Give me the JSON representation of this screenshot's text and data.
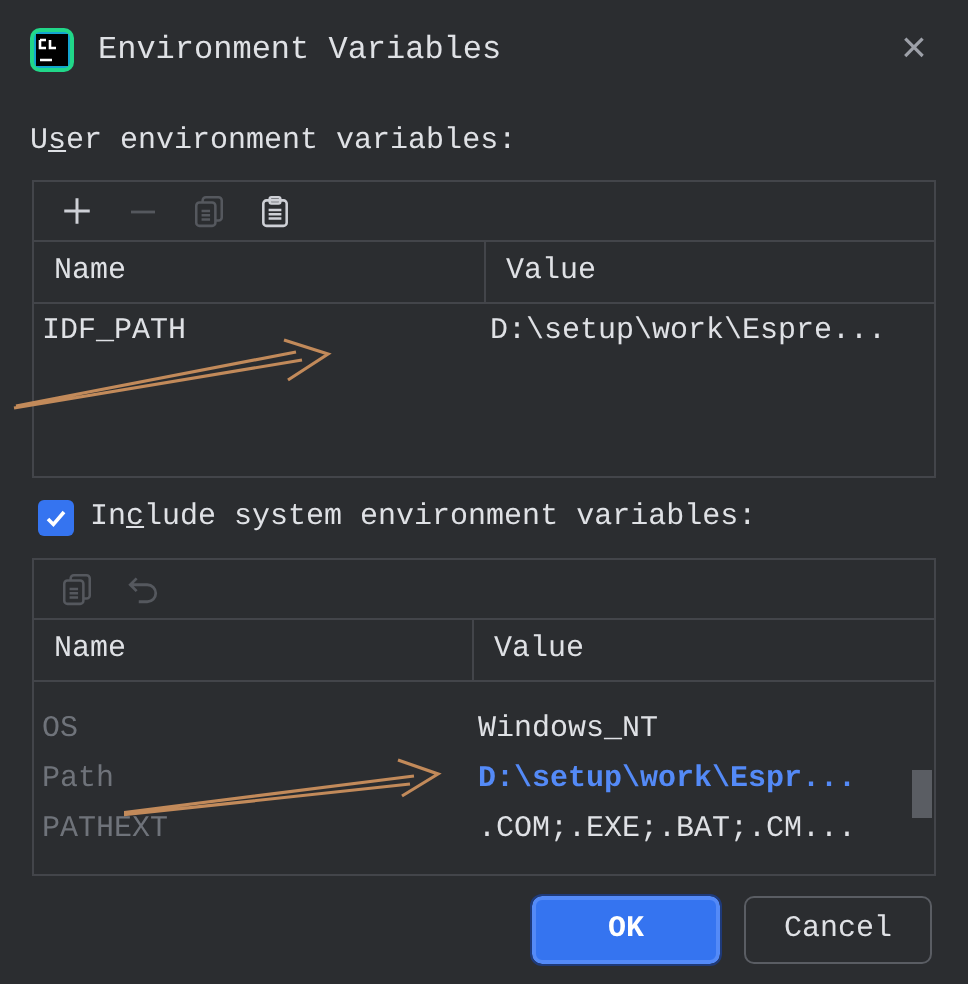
{
  "window": {
    "title": "Environment Variables",
    "close": "×"
  },
  "user_section": {
    "label_before": "U",
    "mnemonic": "s",
    "label_after": "er environment variables:",
    "toolbar": [
      {
        "kind": "add",
        "disabled": false
      },
      {
        "kind": "remove",
        "disabled": true
      },
      {
        "kind": "copy",
        "disabled": true
      },
      {
        "kind": "paste",
        "disabled": false
      }
    ],
    "columns": [
      "Name",
      "Value"
    ],
    "rows": [
      {
        "name": "IDF_PATH",
        "value": "D:\\setup\\work\\Espre...",
        "modified": false
      }
    ]
  },
  "system_section": {
    "checked": true,
    "label_before": "In",
    "mnemonic": "c",
    "label_after": "lude system environment variables:",
    "toolbar": [
      {
        "kind": "copy",
        "disabled": true
      },
      {
        "kind": "undo",
        "disabled": true
      }
    ],
    "columns": [
      "Name",
      "Value"
    ],
    "rows": [
      {
        "name": "OS",
        "value": "Windows_NT",
        "modified": false
      },
      {
        "name": "Path",
        "value": "D:\\setup\\work\\Espr...",
        "modified": true
      },
      {
        "name": "PATHEXT",
        "value": ".COM;.EXE;.BAT;.CM...",
        "modified": false
      }
    ]
  },
  "buttons": [
    {
      "label": "OK",
      "default": true
    },
    {
      "label": "Cancel",
      "default": false
    }
  ]
}
